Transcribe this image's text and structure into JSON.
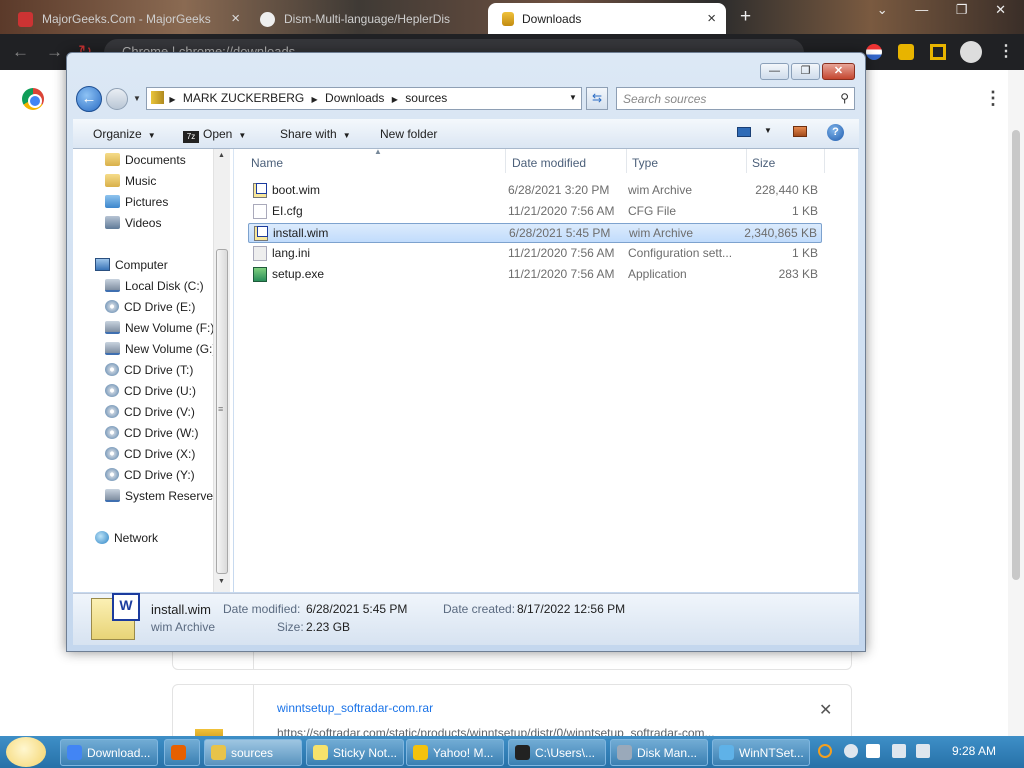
{
  "browser": {
    "tabs": [
      {
        "title": "MajorGeeks.Com - MajorGeeks",
        "active": false
      },
      {
        "title": "Dism-Multi-language/HeplerDis",
        "active": false
      },
      {
        "title": "Downloads",
        "active": true
      }
    ],
    "new_tab": "+",
    "close_glyph": "×",
    "window_controls": "⌄ — ❐ ✕",
    "address_text": "Chrome  |  chrome://downloads",
    "menu_glyph": "⋮"
  },
  "downloads_page": {
    "item": {
      "filename": "winntsetup_softradar-com.rar",
      "url": "https://softradar.com/static/products/winntsetup/distr/0/winntsetup_softradar-com..."
    },
    "close_glyph": "✕"
  },
  "explorer": {
    "caption_buttons": {
      "minimize": "—",
      "maximize": "❐",
      "close": "✕"
    },
    "breadcrumb": [
      "MARK ZUCKERBERG",
      "Downloads",
      "sources"
    ],
    "search_placeholder": "Search sources",
    "command_bar": {
      "organize": "Organize",
      "open": "Open",
      "share_with": "Share with",
      "new_folder": "New folder",
      "sevenzip_badge": "7z"
    },
    "nav_pane": {
      "libraries": [
        "Documents",
        "Music",
        "Pictures",
        "Videos"
      ],
      "computer_label": "Computer",
      "drives": [
        "Local Disk (C:)",
        "CD Drive (E:)",
        "New Volume (F:)",
        "New Volume (G:)",
        "CD Drive (T:)",
        "CD Drive (U:)",
        "CD Drive (V:)",
        "CD Drive (W:)",
        "CD Drive (X:)",
        "CD Drive (Y:)",
        "System Reserved"
      ],
      "network_label": "Network"
    },
    "columns": [
      "Name",
      "Date modified",
      "Type",
      "Size"
    ],
    "files": [
      {
        "name": "boot.wim",
        "date": "6/28/2021 3:20 PM",
        "type": "wim Archive",
        "size": "228,440 KB",
        "icon": "wim-icon",
        "selected": false
      },
      {
        "name": "EI.cfg",
        "date": "11/21/2020 7:56 AM",
        "type": "CFG File",
        "size": "1 KB",
        "icon": "cfg-file-icon",
        "selected": false
      },
      {
        "name": "install.wim",
        "date": "6/28/2021 5:45 PM",
        "type": "wim Archive",
        "size": "2,340,865 KB",
        "icon": "wim-icon",
        "selected": true
      },
      {
        "name": "lang.ini",
        "date": "11/21/2020 7:56 AM",
        "type": "Configuration sett...",
        "size": "1 KB",
        "icon": "ini-file-icon",
        "selected": false
      },
      {
        "name": "setup.exe",
        "date": "11/21/2020 7:56 AM",
        "type": "Application",
        "size": "283 KB",
        "icon": "setup-exe-icon",
        "selected": false
      }
    ],
    "details": {
      "name": "install.wim",
      "type": "wim Archive",
      "modified_label": "Date modified:",
      "modified_value": "6/28/2021 5:45 PM",
      "created_label": "Date created:",
      "created_value": "8/17/2022 12:56 PM",
      "size_label": "Size:",
      "size_value": "2.23 GB"
    }
  },
  "taskbar": {
    "buttons": [
      {
        "label": "Download...",
        "icon": "chrome-icon",
        "color": "#4285f4"
      },
      {
        "label": "",
        "icon": "firefox-icon",
        "color": "#e66000"
      },
      {
        "label": "sources",
        "icon": "folder-icon",
        "color": "#e8c34a"
      },
      {
        "label": "Sticky Not...",
        "icon": "sticky-notes-icon",
        "color": "#f6e26b"
      },
      {
        "label": "Yahoo! M...",
        "icon": "yahoo-icon",
        "color": "#f4c20d"
      },
      {
        "label": "C:\\Users\\...",
        "icon": "7zip-icon",
        "color": "#222222"
      },
      {
        "label": "Disk Man...",
        "icon": "disk-management-icon",
        "color": "#9aa9ba"
      },
      {
        "label": "WinNTSet...",
        "icon": "winntsetup-icon",
        "color": "#5fb2e8"
      }
    ],
    "time": "9:28 AM"
  }
}
